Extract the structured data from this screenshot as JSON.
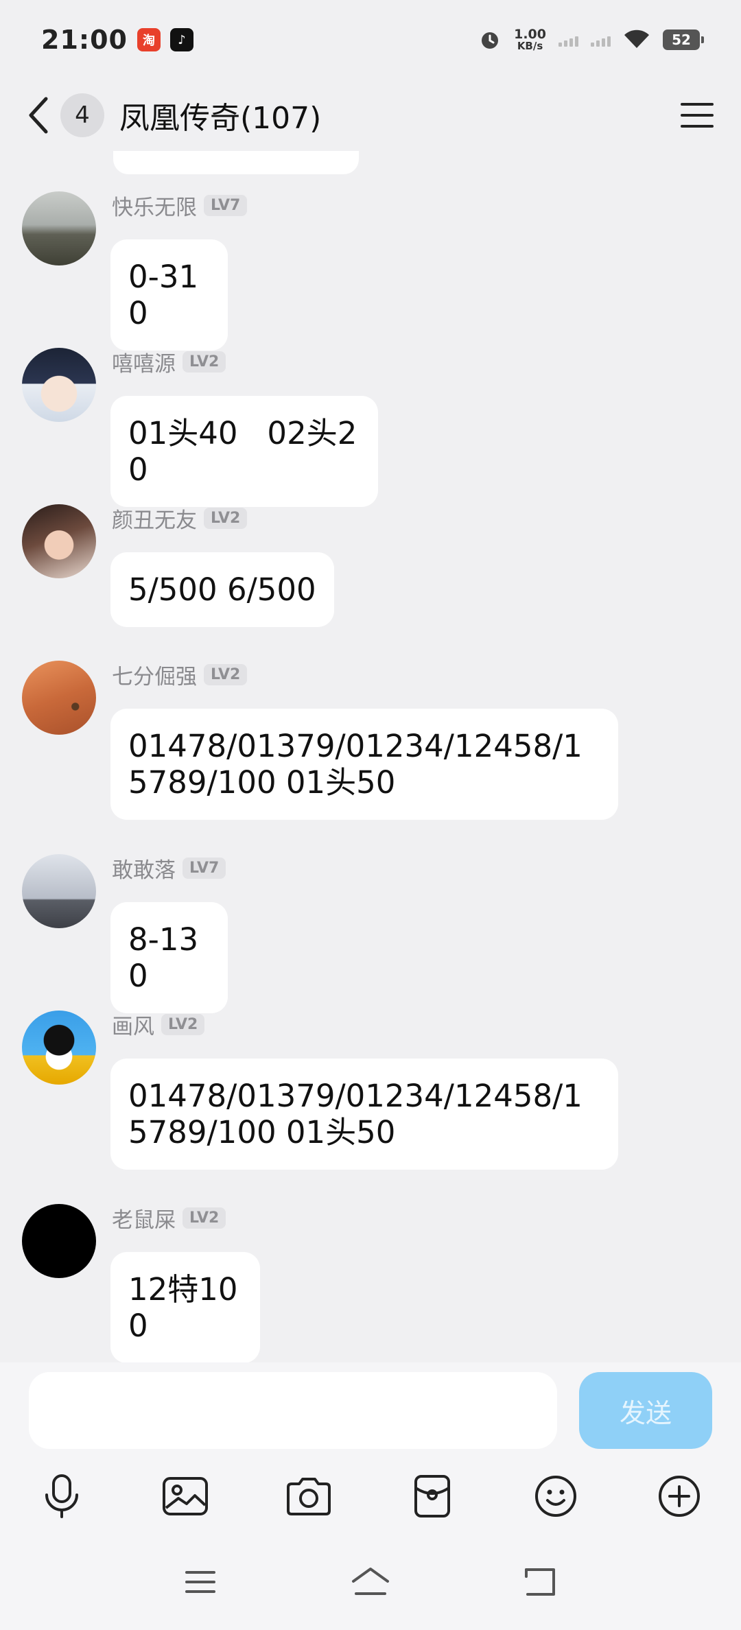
{
  "status_bar": {
    "time": "21:00",
    "net_speed_value": "1.00",
    "net_speed_unit": "KB/s",
    "battery": "52",
    "app_icons": [
      "taobao-icon",
      "tiktok-icon"
    ]
  },
  "header": {
    "unread_count": "4",
    "title": "凤凰传奇(107)"
  },
  "messages": [
    {
      "sender": "快乐无限",
      "level": "LV7",
      "text": "0-310",
      "avatar": "lake-shore-avatar"
    },
    {
      "sender": "嘻嘻源",
      "level": "LV2",
      "text": "01头40   02头20",
      "avatar": "anime-boy-avatar"
    },
    {
      "sender": "颜丑无友",
      "level": "LV2",
      "text": "5/500 6/500",
      "avatar": "girl-photo-avatar"
    },
    {
      "sender": "七分倔强",
      "level": "LV2",
      "text": "01478/01379/01234/12458/15789/100 01头50",
      "avatar": "desert-avatar"
    },
    {
      "sender": "敢敢落",
      "level": "LV7",
      "text": "8-130",
      "avatar": "bridge-avatar"
    },
    {
      "sender": "画风",
      "level": "LV2",
      "text": "01478/01379/01234/12458/15789/100 01头50",
      "avatar": "qq-penguin-avatar"
    },
    {
      "sender": "老鼠屎",
      "level": "LV2",
      "text": "12特100",
      "avatar": "black-avatar"
    }
  ],
  "input": {
    "value": "",
    "send_label": "发送"
  },
  "toolbar": [
    "microphone-icon",
    "image-icon",
    "camera-icon",
    "red-packet-icon",
    "emoji-icon",
    "plus-icon"
  ],
  "nav": [
    "menu-icon",
    "home-icon",
    "back-icon"
  ],
  "colors": {
    "background": "#f0f0f2",
    "bubble": "#ffffff",
    "send_button": "#8fd0f7",
    "sender_name": "#8a8a8e"
  }
}
